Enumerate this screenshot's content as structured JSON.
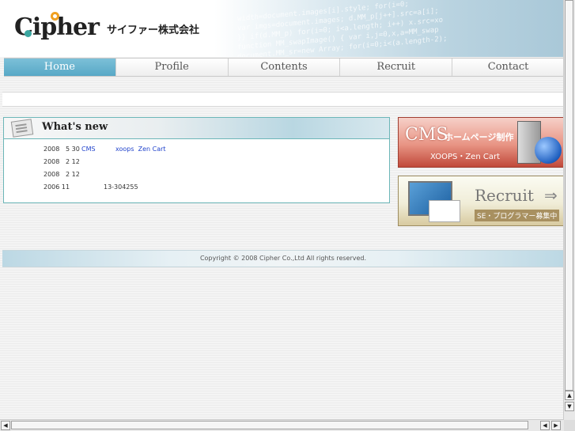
{
  "header": {
    "logo_text": "Cipher",
    "company_jp": "サイファー株式会社",
    "bg_code_lines": [
      "width=document.images[i].style; for(i=0;",
      "var imgs=document.images; d.MM_p[j++].src=a[i];",
      "}} if(d.MM_p) for(i=0; i<a.length; i++) x.src=xo",
      "function MM_swapImage() { var i,j=0,x,a=MM_swap",
      "document.MM_sr=new Array; for(i=0;i<(a.length-2);"
    ]
  },
  "nav": {
    "items": [
      {
        "label": "Home",
        "active": true
      },
      {
        "label": "Profile",
        "active": false
      },
      {
        "label": "Contents",
        "active": false
      },
      {
        "label": "Recruit",
        "active": false
      },
      {
        "label": "Contact",
        "active": false
      }
    ]
  },
  "news": {
    "title": "What's new",
    "items": [
      {
        "date": "2008   5 30",
        "text": "CMS",
        "link1": "CMS",
        "middle": "          ",
        "link2": "xoops  Zen Cart"
      },
      {
        "date": "2008   2 12",
        "text": ""
      },
      {
        "date": "2008   2 12",
        "text": ""
      },
      {
        "date": "2006 11",
        "text": "           13-304255"
      }
    ]
  },
  "banners": {
    "cms": {
      "big": "CMS",
      "jp": "ホームページ制作",
      "sub": "XOOPS・Zen Cart"
    },
    "recruit": {
      "title": "Recruit",
      "arrow": "⇒",
      "sub": "SE・プログラマー募集中"
    }
  },
  "footer": {
    "copyright": "Copyright © 2008 Cipher Co.,Ltd All rights reserved."
  },
  "scrollbars": {
    "up": "▲",
    "down": "▼",
    "left": "◀",
    "right": "▶"
  },
  "colors": {
    "accent": "#58a8c6",
    "border": "#6cb6b8",
    "link": "#2244cc"
  }
}
